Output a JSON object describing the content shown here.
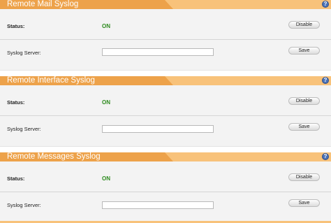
{
  "sections": [
    {
      "title": "Remote Mail Syslog",
      "status_label": "Status:",
      "status_value": "ON",
      "disable_label": "Disable",
      "server_label": "Syslog Server:",
      "server_value": "",
      "save_label": "Save"
    },
    {
      "title": "Remote Interface Syslog",
      "status_label": "Status:",
      "status_value": "ON",
      "disable_label": "Disable",
      "server_label": "Syslog Server:",
      "server_value": "",
      "save_label": "Save"
    },
    {
      "title": "Remote Messages Syslog",
      "status_label": "Status:",
      "status_value": "ON",
      "disable_label": "Disable",
      "server_label": "Syslog Server:",
      "server_value": "",
      "save_label": "Save"
    }
  ],
  "help_glyph": "?",
  "colors": {
    "header_dark": "#eda24a",
    "header_light": "#f8c27a",
    "status_on": "#2e8b1f",
    "panel_bg": "#f3f3f3"
  }
}
